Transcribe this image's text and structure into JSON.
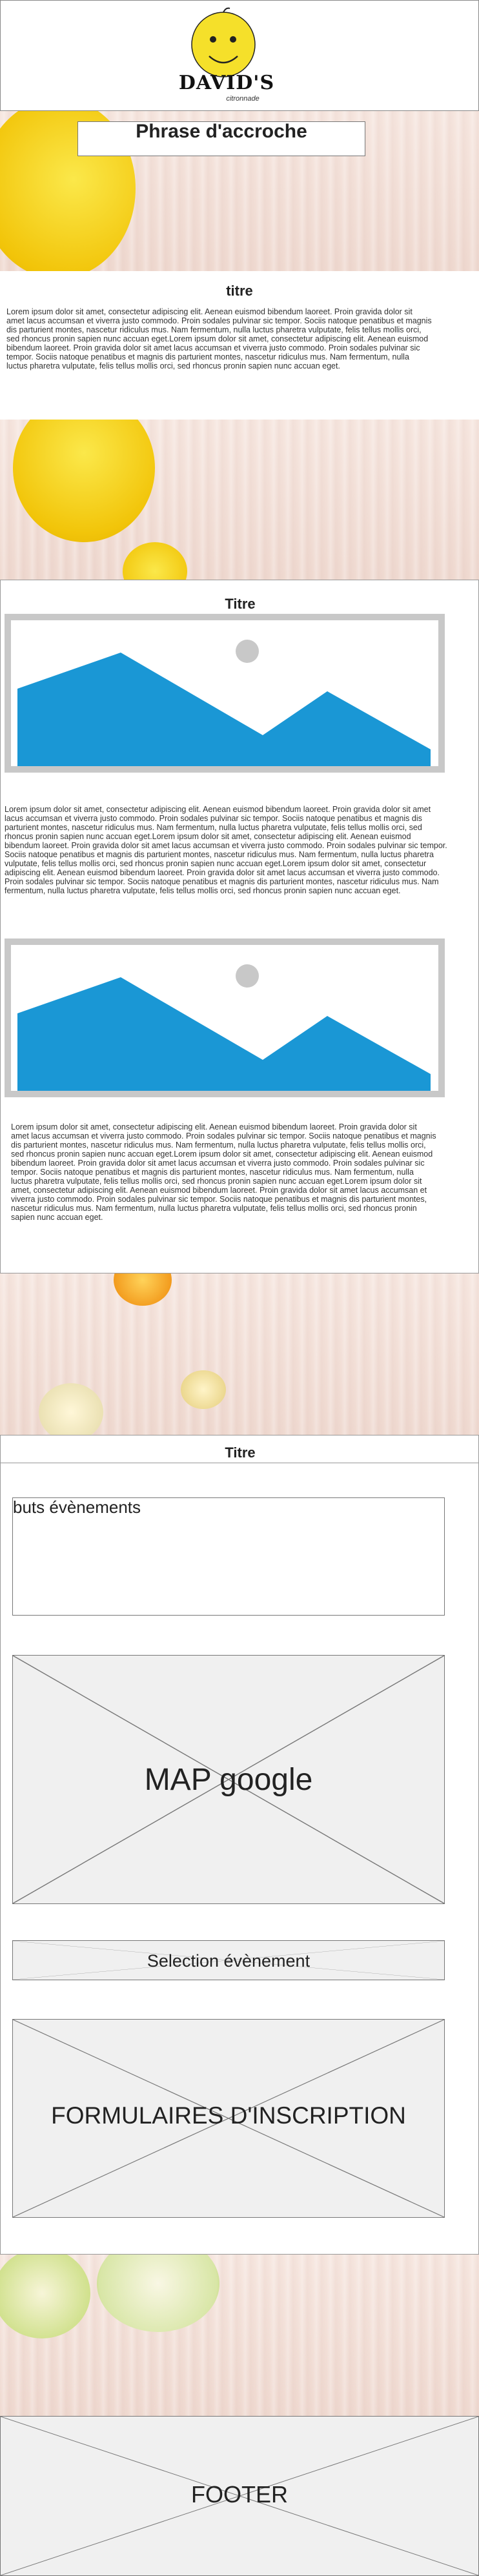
{
  "header": {
    "logo_text": "DAVID'S",
    "logo_sub": "citronnade"
  },
  "hero": {
    "tagline": "Phrase d'accroche"
  },
  "section1": {
    "title": "titre",
    "text": "Lorem ipsum dolor sit amet, consectetur adipiscing elit. Aenean euismod bibendum laoreet. Proin gravida dolor sit amet lacus accumsan et viverra justo commodo. Proin sodales pulvinar sic tempor. Sociis natoque penatibus et magnis dis parturient montes, nascetur ridiculus mus. Nam fermentum, nulla luctus pharetra vulputate, felis tellus mollis orci, sed rhoncus pronin sapien nunc accuan eget.Lorem ipsum dolor sit amet, consectetur adipiscing elit. Aenean euismod bibendum laoreet. Proin gravida dolor sit amet lacus accumsan et viverra justo commodo. Proin sodales pulvinar sic tempor. Sociis natoque penatibus et magnis dis parturient montes, nascetur ridiculus mus. Nam fermentum, nulla luctus pharetra vulputate, felis tellus mollis orci, sed rhoncus pronin sapien nunc accuan eget."
  },
  "section2": {
    "title": "Titre",
    "text1": "Lorem ipsum dolor sit amet, consectetur adipiscing elit. Aenean euismod bibendum laoreet. Proin gravida dolor sit amet lacus accumsan et viverra justo commodo. Proin sodales pulvinar sic tempor. Sociis natoque penatibus et magnis dis parturient montes, nascetur ridiculus mus. Nam fermentum, nulla luctus pharetra vulputate, felis tellus mollis orci, sed rhoncus pronin sapien nunc accuan eget.Lorem ipsum dolor sit amet, consectetur adipiscing elit. Aenean euismod bibendum laoreet. Proin gravida dolor sit amet lacus accumsan et viverra justo commodo. Proin sodales pulvinar sic tempor. Sociis natoque penatibus et magnis dis parturient montes, nascetur ridiculus mus. Nam fermentum, nulla luctus pharetra vulputate, felis tellus mollis orci, sed rhoncus pronin sapien nunc accuan eget.Lorem ipsum dolor sit amet, consectetur adipiscing elit. Aenean euismod bibendum laoreet. Proin gravida dolor sit amet lacus accumsan et viverra justo commodo. Proin sodales pulvinar sic tempor. Sociis natoque penatibus et magnis dis parturient montes, nascetur ridiculus mus. Nam fermentum, nulla luctus pharetra vulputate, felis tellus mollis orci, sed rhoncus pronin sapien nunc accuan eget.",
    "text2": "Lorem ipsum dolor sit amet, consectetur adipiscing elit. Aenean euismod bibendum laoreet. Proin gravida dolor sit amet lacus accumsan et viverra justo commodo. Proin sodales pulvinar sic tempor. Sociis natoque penatibus et magnis dis parturient montes, nascetur ridiculus mus. Nam fermentum, nulla luctus pharetra vulputate, felis tellus mollis orci, sed rhoncus pronin sapien nunc accuan eget.Lorem ipsum dolor sit amet, consectetur adipiscing elit. Aenean euismod bibendum laoreet. Proin gravida dolor sit amet lacus accumsan et viverra justo commodo. Proin sodales pulvinar sic tempor. Sociis natoque penatibus et magnis dis parturient montes, nascetur ridiculus mus. Nam fermentum, nulla luctus pharetra vulputate, felis tellus mollis orci, sed rhoncus pronin sapien nunc accuan eget.Lorem ipsum dolor sit amet, consectetur adipiscing elit. Aenean euismod bibendum laoreet. Proin gravida dolor sit amet lacus accumsan et viverra justo commodo. Proin sodales pulvinar sic tempor. Sociis natoque penatibus et magnis dis parturient montes, nascetur ridiculus mus. Nam fermentum, nulla luctus pharetra vulputate, felis tellus mollis orci, sed rhoncus pronin sapien nunc accuan eget."
  },
  "section3": {
    "title": "Titre",
    "events_label": "buts évènements",
    "map_label": "MAP google",
    "selection_label": "Selection évènement",
    "form_label": "FORMULAIRES D'INSCRIPTION"
  },
  "footer": {
    "label": "FOOTER"
  },
  "colors": {
    "lemon": "#f5e02a",
    "image_blue": "#1a97d5",
    "image_frame": "#c8c8c8"
  }
}
